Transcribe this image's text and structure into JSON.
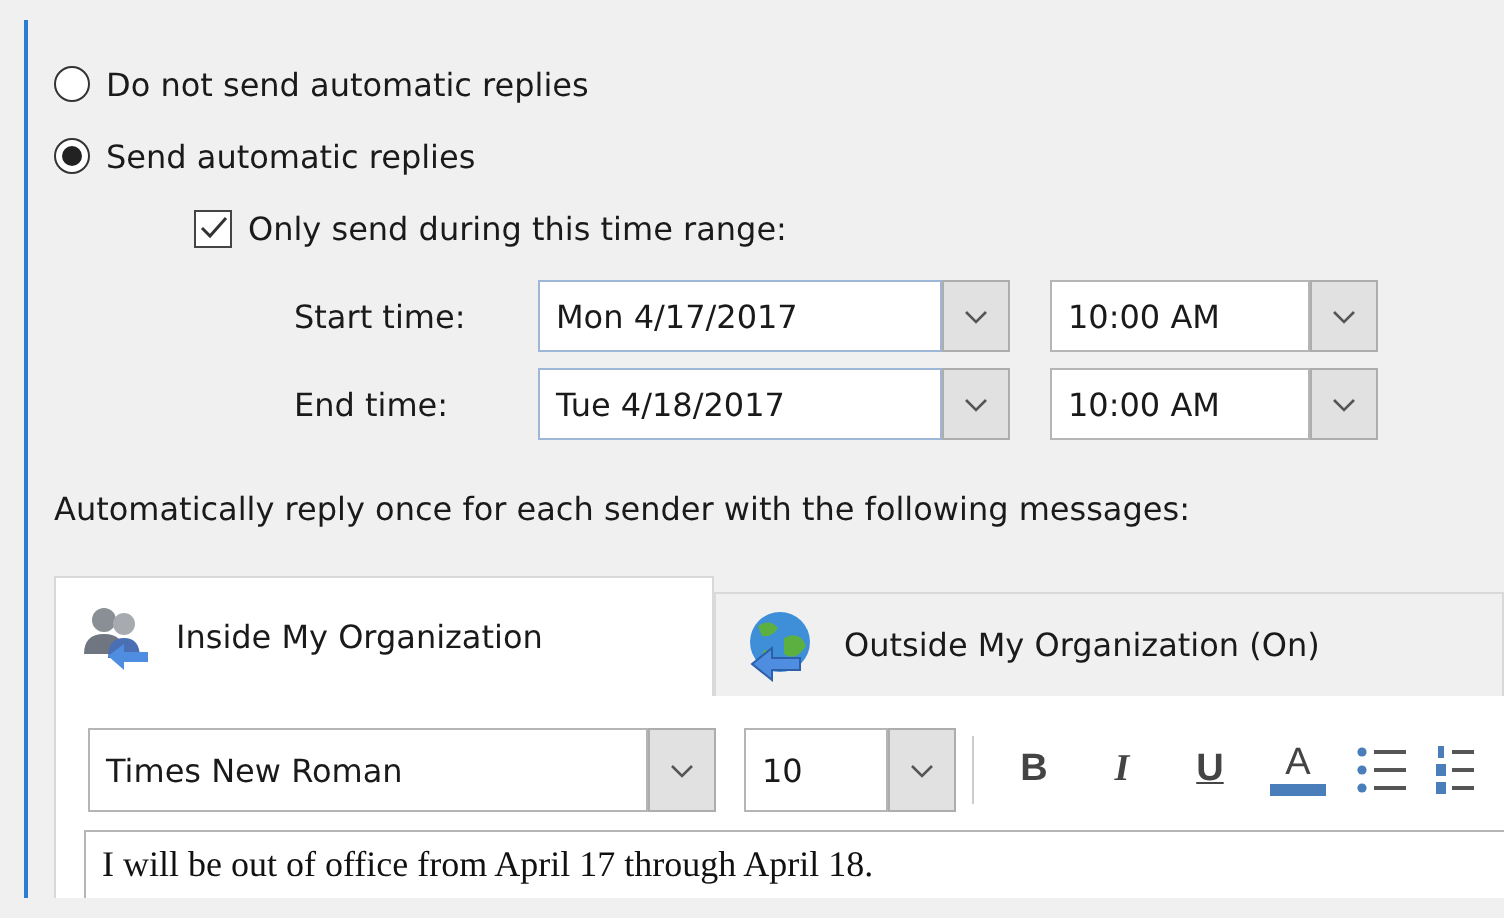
{
  "options": [
    {
      "label": "Do not send automatic replies",
      "selected": false
    },
    {
      "label": "Send automatic replies",
      "selected": true
    }
  ],
  "time_range": {
    "label": "Only send during this time range:",
    "checked": true,
    "rows": [
      {
        "label": "Start time:",
        "date": "Mon 4/17/2017",
        "time": "10:00 AM"
      },
      {
        "label": "End time:",
        "date": "Tue 4/18/2017",
        "time": "10:00 AM"
      }
    ]
  },
  "reply_label": "Automatically reply once for each sender with the following messages:",
  "tabs": [
    {
      "label": "Inside My Organization",
      "selected": true,
      "kind": "people"
    },
    {
      "label": "Outside My Organization (On)",
      "selected": false,
      "kind": "globe"
    }
  ],
  "toolbar": {
    "font": "Times New Roman",
    "size": "10",
    "buttons": [
      {
        "kind": "bold",
        "label": "B"
      },
      {
        "kind": "italic",
        "label": "I"
      },
      {
        "kind": "underline",
        "label": "U"
      },
      {
        "kind": "color",
        "label": "A"
      },
      {
        "kind": "bullets"
      },
      {
        "kind": "numbering"
      }
    ]
  },
  "message": "I will be out of office from April 17 through April 18."
}
